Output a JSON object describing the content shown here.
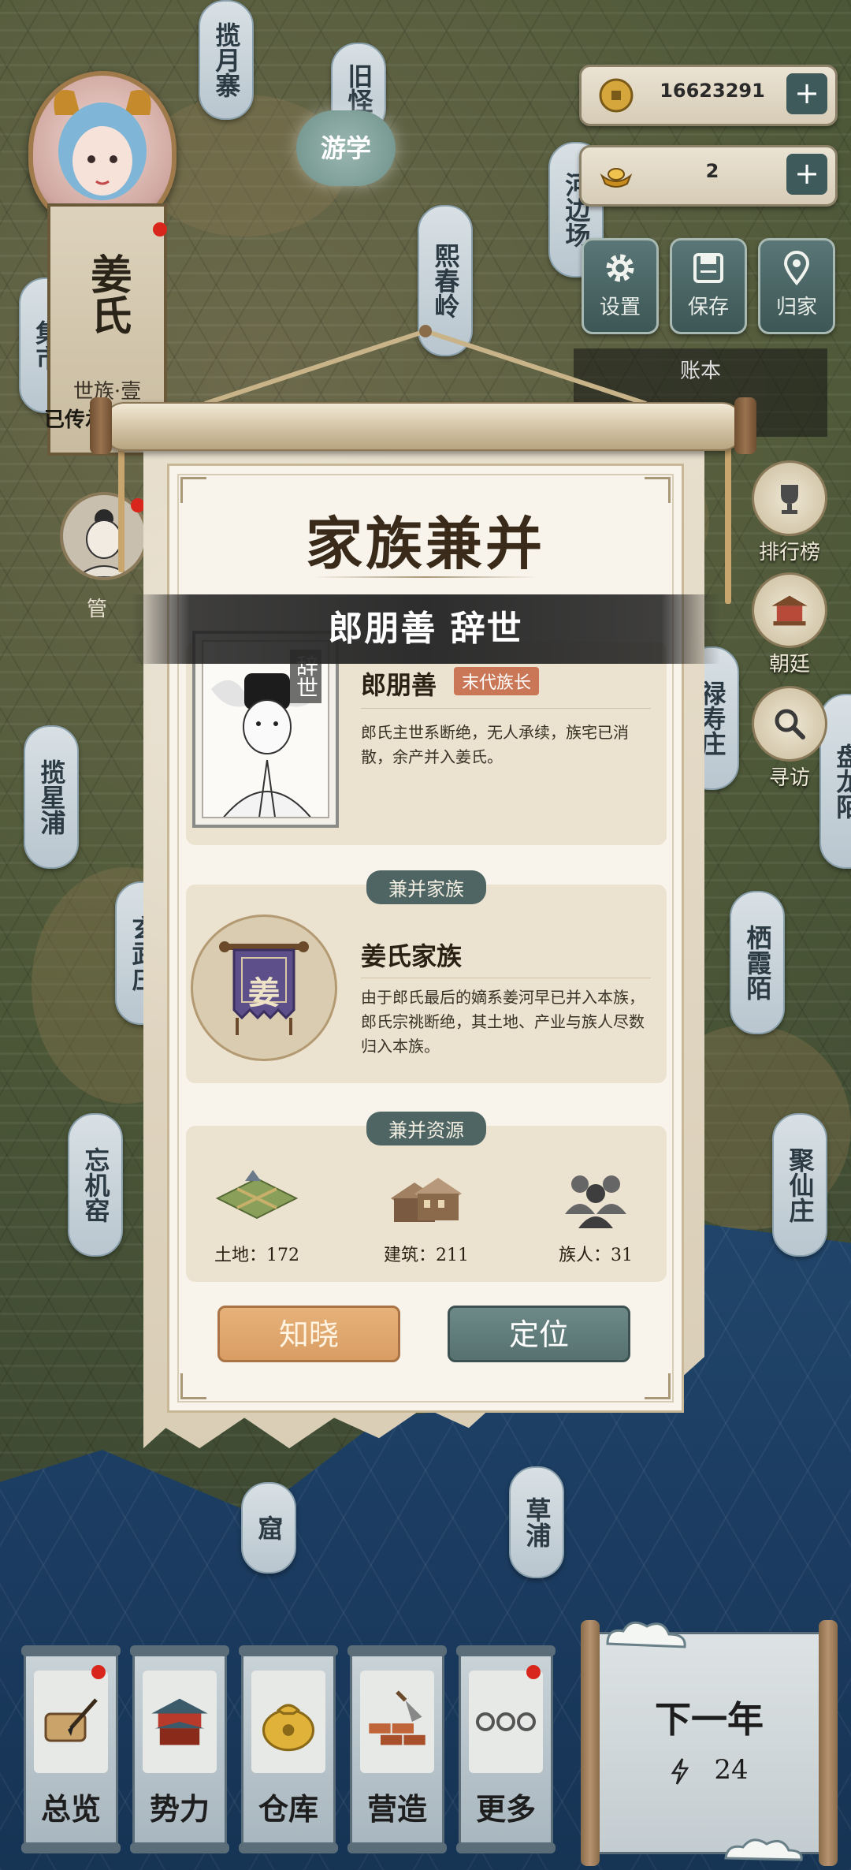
{
  "map": {
    "places": [
      {
        "name": "揽月寨"
      },
      {
        "name": "旧怪"
      },
      {
        "name": "游学"
      },
      {
        "name": "河边场"
      },
      {
        "name": "熙春岭"
      },
      {
        "name": "集市"
      },
      {
        "name": "揽星浦"
      },
      {
        "name": "玄武庄"
      },
      {
        "name": "忘机窑"
      },
      {
        "name": "禄寿庄"
      },
      {
        "name": "盘龙陌"
      },
      {
        "name": "栖霞陌"
      },
      {
        "name": "聚仙庄"
      },
      {
        "name": "窟"
      },
      {
        "name": "草浦"
      }
    ]
  },
  "currency": {
    "coins": "16623291",
    "gold": "2",
    "plus": "+"
  },
  "system": {
    "settings": "设置",
    "save": "保存",
    "home": "归家",
    "ledger": "账本"
  },
  "player": {
    "name": "姜氏",
    "rank": "世族·壹",
    "legacy": "已传承",
    "advisor_label": "管"
  },
  "right_menu": {
    "ranking": "排行榜",
    "court": "朝廷",
    "visit": "寻访"
  },
  "modal": {
    "title": "家族兼并",
    "banner": "郎朋善 辞世",
    "deceased": {
      "tag": "辞世",
      "name": "郎朋善",
      "badge": "末代族长",
      "desc": "郎氏主世系断绝，无人承续，族宅已消散，余产并入姜氏。"
    },
    "merge_family": {
      "header": "兼并家族",
      "flag_char": "姜",
      "name": "姜氏家族",
      "desc": "由于郎氏最后的嫡系姜河早已并入本族，郎氏宗祧断绝，其土地、产业与族人尽数归入本族。"
    },
    "merge_resources": {
      "header": "兼并资源",
      "land": "土地：172",
      "buildings": "建筑：211",
      "members": "族人：31"
    },
    "buttons": {
      "ok": "知晓",
      "locate": "定位"
    }
  },
  "dock": {
    "overview": "总览",
    "power": "势力",
    "warehouse": "仓库",
    "build": "营造",
    "more": "更多"
  },
  "next_year": {
    "label": "下一年",
    "energy": "24"
  },
  "colors": {
    "accent_teal": "#4e6564",
    "ok_button": "#d99d63",
    "badge": "#c97756",
    "notice_dot": "#d9261c"
  }
}
